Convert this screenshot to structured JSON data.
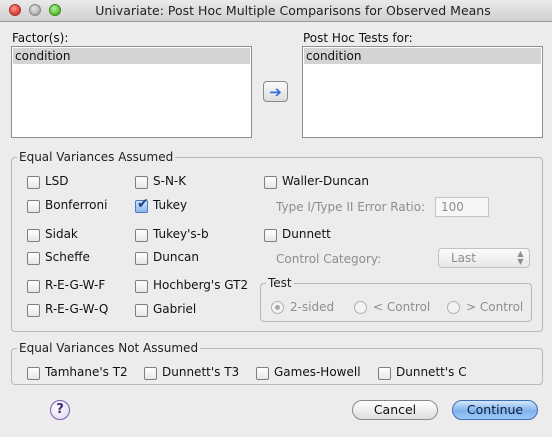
{
  "window": {
    "title": "Univariate: Post Hoc Multiple Comparisons for Observed Means"
  },
  "factors": {
    "label": "Factor(s):",
    "items": [
      "condition"
    ]
  },
  "posthoc_for": {
    "label": "Post Hoc Tests for:",
    "items": [
      "condition"
    ]
  },
  "move_button": {
    "icon": "right-arrow-icon"
  },
  "equal_variances": {
    "legend": "Equal Variances Assumed",
    "options": {
      "lsd": {
        "label": "LSD",
        "checked": false
      },
      "bonferroni": {
        "label": "Bonferroni",
        "checked": false
      },
      "sidak": {
        "label": "Sidak",
        "checked": false
      },
      "scheffe": {
        "label": "Scheffe",
        "checked": false
      },
      "regwf": {
        "label": "R-E-G-W-F",
        "checked": false
      },
      "regwq": {
        "label": "R-E-G-W-Q",
        "checked": false
      },
      "snk": {
        "label": "S-N-K",
        "checked": false
      },
      "tukey": {
        "label": "Tukey",
        "checked": true
      },
      "tukeysb": {
        "label": "Tukey's-b",
        "checked": false
      },
      "duncan": {
        "label": "Duncan",
        "checked": false
      },
      "hochberg": {
        "label": "Hochberg's GT2",
        "checked": false
      },
      "gabriel": {
        "label": "Gabriel",
        "checked": false
      },
      "waller": {
        "label": "Waller-Duncan",
        "checked": false
      },
      "dunnett": {
        "label": "Dunnett",
        "checked": false
      }
    },
    "error_ratio": {
      "label": "Type I/Type II Error Ratio:",
      "value": "100"
    },
    "control_category": {
      "label": "Control Category:",
      "value": "Last"
    },
    "test": {
      "legend": "Test",
      "options": [
        "2-sided",
        "< Control",
        "> Control"
      ],
      "selected": "2-sided"
    }
  },
  "unequal_variances": {
    "legend": "Equal Variances Not Assumed",
    "options": {
      "tamhane": {
        "label": "Tamhane's T2",
        "checked": false
      },
      "dunnett_t3": {
        "label": "Dunnett's T3",
        "checked": false
      },
      "games_howell": {
        "label": "Games-Howell",
        "checked": false
      },
      "dunnett_c": {
        "label": "Dunnett's C",
        "checked": false
      }
    }
  },
  "footer": {
    "help_label": "?",
    "cancel_label": "Cancel",
    "continue_label": "Continue"
  }
}
